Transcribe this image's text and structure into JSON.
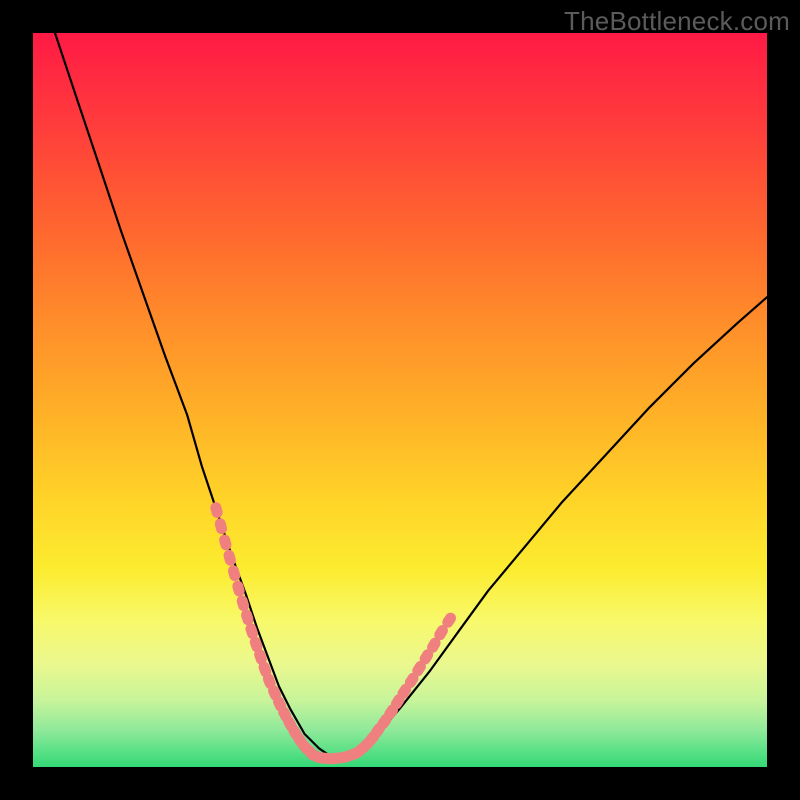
{
  "watermark": "TheBottleneck.com",
  "colors": {
    "background_frame": "#000000",
    "gradient_top": "#ff1a45",
    "gradient_bottom": "#33d977",
    "curve": "#000000",
    "marker": "#f08080"
  },
  "chart_data": {
    "type": "line",
    "title": "",
    "xlabel": "",
    "ylabel": "",
    "xlim": [
      0,
      100
    ],
    "ylim": [
      0,
      100
    ],
    "grid": false,
    "legend": false,
    "series": [
      {
        "name": "bottleneck-curve",
        "description": "V-shaped curve: bottleneck percentage vs component balance (approximate — axes unlabeled in source)",
        "x": [
          3,
          6,
          9,
          12,
          15,
          18,
          21,
          23,
          25,
          27,
          29,
          30.5,
          32,
          33.5,
          35,
          37,
          39,
          40.5,
          42,
          44,
          47,
          50,
          54,
          58,
          62,
          67,
          72,
          78,
          84,
          90,
          96,
          100
        ],
        "y": [
          100,
          91,
          82,
          73,
          64.5,
          56,
          48,
          41,
          35,
          29,
          23.5,
          19,
          15,
          11,
          8,
          4.5,
          2.5,
          1.5,
          1.2,
          2,
          4.5,
          8,
          13,
          18.5,
          24,
          30,
          36,
          42.5,
          49,
          55,
          60.5,
          64
        ]
      },
      {
        "name": "marker-cluster-left",
        "description": "Dense salmon data-point cluster on descending arm near trough",
        "type": "scatter",
        "x": [
          25,
          25.6,
          26.2,
          26.8,
          27.4,
          28,
          28.6,
          29.2,
          29.8,
          30.4,
          31,
          31.6,
          32.2,
          32.9,
          33.6,
          34.3,
          35,
          35.7,
          36.4,
          37.1,
          37.8
        ],
        "y": [
          35,
          32.8,
          30.6,
          28.5,
          26.4,
          24.3,
          22.3,
          20.4,
          18.5,
          16.7,
          15,
          13.3,
          11.7,
          10.1,
          8.6,
          7.2,
          5.9,
          4.7,
          3.6,
          2.7,
          2.0
        ]
      },
      {
        "name": "marker-cluster-bottom",
        "description": "Flat bottom segment of markers at trough",
        "type": "scatter",
        "x": [
          38.3,
          39,
          39.8,
          40.6,
          41.4,
          42.2,
          43,
          43.8
        ],
        "y": [
          1.6,
          1.3,
          1.2,
          1.15,
          1.2,
          1.3,
          1.5,
          1.8
        ]
      },
      {
        "name": "marker-cluster-right",
        "description": "Dense salmon data-point cluster on ascending arm leaving trough",
        "type": "scatter",
        "x": [
          44.6,
          45.4,
          46.2,
          47,
          47.9,
          48.8,
          49.7,
          50.6,
          51.6,
          52.6,
          53.6,
          54.6,
          55.6,
          56.7
        ],
        "y": [
          2.3,
          3.0,
          3.9,
          5.0,
          6.2,
          7.5,
          8.9,
          10.3,
          11.8,
          13.4,
          15.0,
          16.6,
          18.3,
          20.0
        ]
      }
    ]
  }
}
